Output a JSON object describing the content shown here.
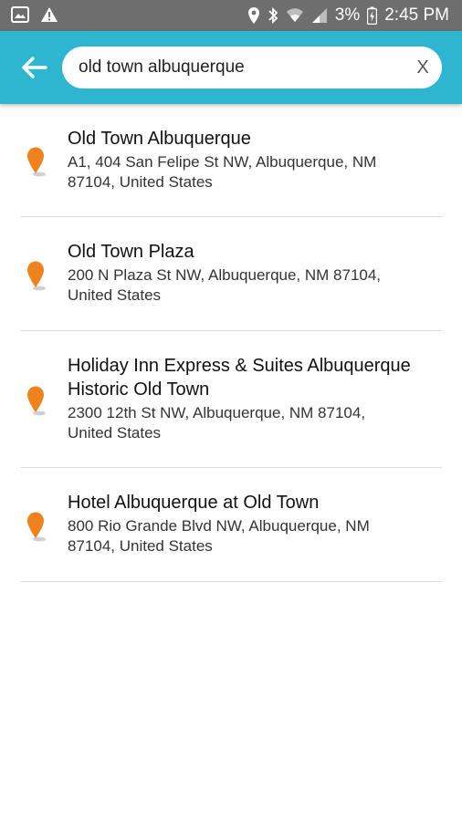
{
  "status_bar": {
    "battery_percent": "3%",
    "time": "2:45 PM",
    "left_icons": [
      "gallery-icon",
      "warning-icon"
    ],
    "right_icons": [
      "location-icon",
      "bluetooth-icon",
      "wifi-icon",
      "signal-icon",
      "battery-charging-icon"
    ]
  },
  "search": {
    "query": "old town albuquerque",
    "clear_label": "X",
    "back_icon": "back-arrow-icon"
  },
  "colors": {
    "app_bar": "#2eb5cf",
    "status_bar": "#6e6e6e",
    "pin": "#f0821e"
  },
  "results": [
    {
      "title": "Old Town Albuquerque",
      "address_line1": "A1, 404 San Felipe St NW, Albuquerque, NM",
      "address_line2": "87104, United States",
      "icon": "map-pin-icon"
    },
    {
      "title": "Old Town Plaza",
      "address_line1": "200 N Plaza St NW, Albuquerque, NM 87104,",
      "address_line2": "United States",
      "icon": "map-pin-icon"
    },
    {
      "title_line1": "Holiday Inn Express & Suites Albuquerque",
      "title_line2": "Historic Old Town",
      "address_line1": "2300 12th St NW, Albuquerque, NM 87104,",
      "address_line2": "United States",
      "icon": "map-pin-icon"
    },
    {
      "title": "Hotel Albuquerque at Old Town",
      "address_line1": "800 Rio Grande Blvd NW, Albuquerque, NM",
      "address_line2": "87104, United States",
      "icon": "map-pin-icon"
    }
  ]
}
